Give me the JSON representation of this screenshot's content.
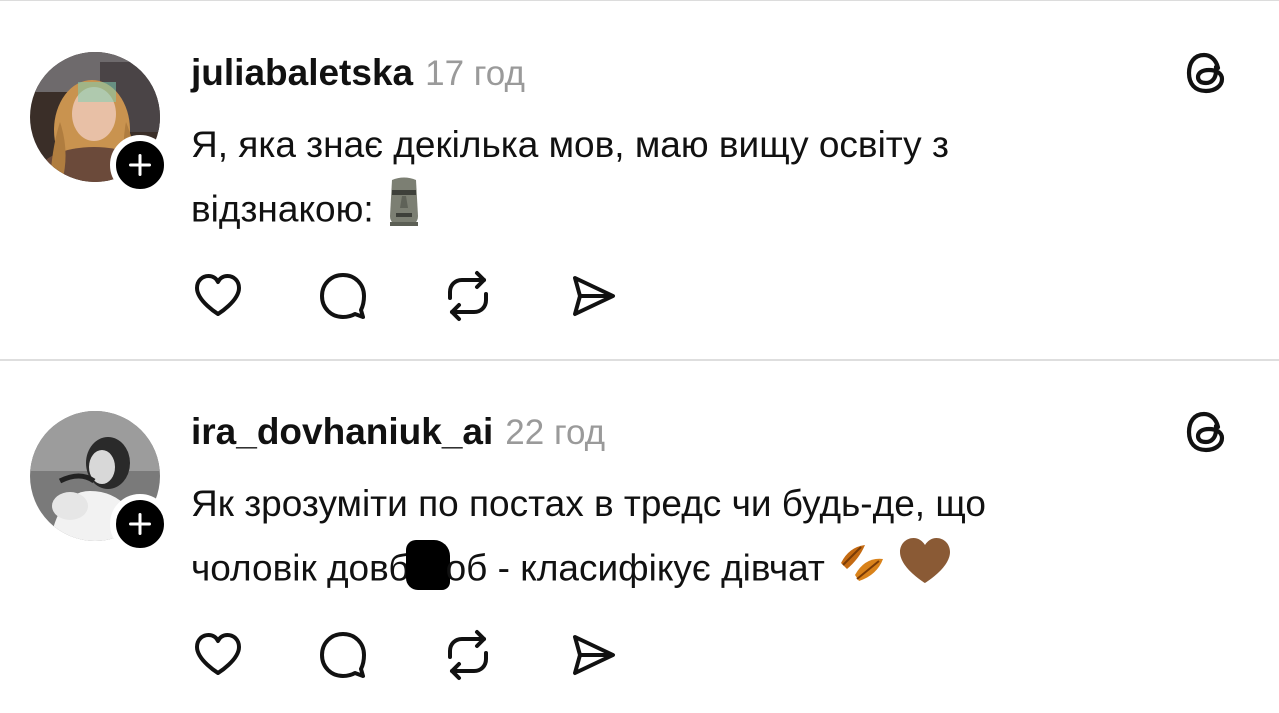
{
  "posts": [
    {
      "username": "juliabaletska",
      "timestamp": "17 год",
      "text_line1": "Я, яка знає декілька мов, маю вищу освіту з",
      "text_line2": "відзнакою:",
      "emoji": [
        "moai"
      ]
    },
    {
      "username": "ira_dovhaniuk_ai",
      "timestamp": "22 год",
      "text_line1": "Як зрозуміти по постах в тредс чи будь-де, що",
      "text_line2_before": "чоловік довб",
      "text_line2_after": "об - класифікує дівчат",
      "emoji": [
        "fallen-leaf",
        "brown-heart"
      ]
    }
  ],
  "icons": {
    "like": "heart-icon",
    "reply": "comment-icon",
    "repost": "repost-icon",
    "share": "share-icon",
    "brand": "threads-logo-icon",
    "follow": "plus-icon"
  },
  "colors": {
    "text": "#111111",
    "muted": "#9a9a9a",
    "divider": "#dedede",
    "follow_bg": "#000000"
  }
}
